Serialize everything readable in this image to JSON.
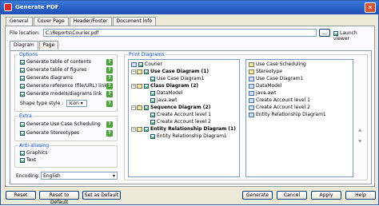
{
  "window": {
    "title": "Generate PDF",
    "close": "✕"
  },
  "tabs": [
    "General",
    "Cover Page",
    "Header/Footer",
    "Document Info"
  ],
  "file": {
    "label": "File location:",
    "value": "C:\\Reports\\Courier.pdf",
    "browse": "...",
    "launch_label": "Launch viewer"
  },
  "subtabs": [
    "Diagram",
    "Page"
  ],
  "options": {
    "title": "Options",
    "items": [
      "Generate table of contents",
      "Generate table of figures",
      "Generate diagrams",
      "Generate reference (file/URL) link",
      "Generate models/diagrams link"
    ],
    "shape_style_label": "Shape type style :",
    "shape_style_value": "Icon"
  },
  "extra": {
    "title": "Extra",
    "items": [
      "Generate Use Case Scheduling",
      "Generate Stereotypes"
    ]
  },
  "anti": {
    "title": "Anti-aliasing",
    "items": [
      "Graphics",
      "Text"
    ]
  },
  "encoding": {
    "label": "Encoding:",
    "value": "English"
  },
  "print_diagrams": {
    "title": "Print Diagrams",
    "left": [
      {
        "text": "Courier",
        "level": 0
      },
      {
        "text": "Use Case Diagram (1)",
        "level": 1,
        "bold": true
      },
      {
        "text": "Use Case Diagram1",
        "level": 2
      },
      {
        "text": "Class Diagram (2)",
        "level": 1,
        "bold": true
      },
      {
        "text": "DataModel",
        "level": 2
      },
      {
        "text": "java.awt",
        "level": 2
      },
      {
        "text": "Sequence Diagram (2)",
        "level": 1,
        "bold": true
      },
      {
        "text": "Create Account level 1",
        "level": 2
      },
      {
        "text": "Create Account level 2",
        "level": 2
      },
      {
        "text": "Entity Relationship Diagram (1)",
        "level": 1,
        "bold": true
      },
      {
        "text": "Entity Relationship Diagram1",
        "level": 2
      }
    ],
    "right": [
      "Use Case Scheduling",
      "Stereotype",
      "Use Case Diagram1",
      "DataModel",
      "java.awt",
      "Create Account level 1",
      "Create Account level 2",
      "Entity Relationship Diagram1"
    ]
  },
  "buttons": {
    "reset": "Reset",
    "reset_default": "Reset to Default",
    "save_default": "Set as Default",
    "generate": "Generate",
    "cancel": "Cancel",
    "apply": "Apply",
    "help": "Help"
  },
  "help_glyph": "?",
  "arrows": {
    "up": "⯅",
    "down": "⯆"
  }
}
